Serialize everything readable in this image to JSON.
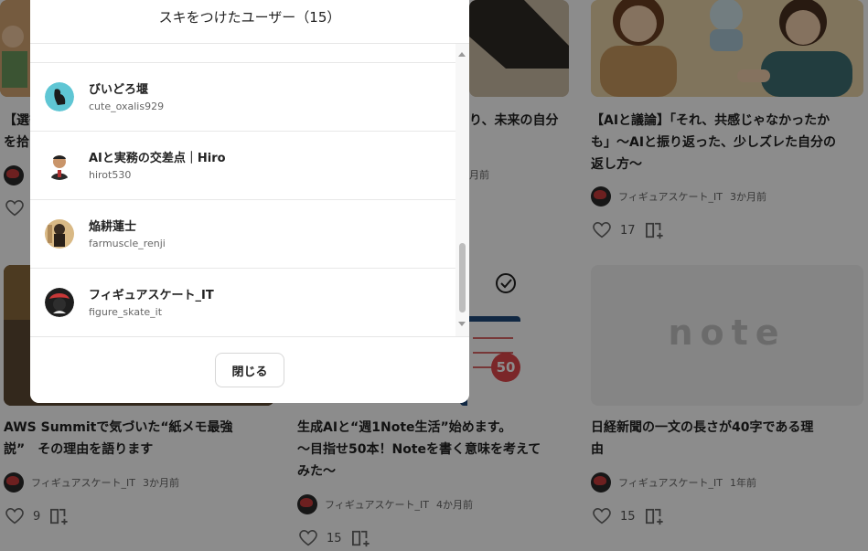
{
  "modal": {
    "title": "スキをつけたユーザー（15）",
    "close_label": "閉じる",
    "users": [
      {
        "name": "びいどろ堰",
        "handle": "cute_oxalis929"
      },
      {
        "name": "AIと実務の交差点｜Hiro",
        "handle": "hirot530"
      },
      {
        "name": "焔耕蓮士",
        "handle": "farmuscle_renji"
      },
      {
        "name": "フィギュアスケート_IT",
        "handle": "figure_skate_it"
      }
    ]
  },
  "cards": {
    "c1": {
      "title_l1": "【選挙",
      "title_l2": "を拾"
    },
    "c2": {
      "title": "り、未来の自分",
      "time": "月前"
    },
    "c3": {
      "title_l1": "【AIと議論】「それ、共感じゃなかったか",
      "title_l2": "も」〜AIと振り返った、少しズレた自分の",
      "title_l3": "返し方〜",
      "author": "フィギュアスケート_IT",
      "time": "3か月前",
      "likes": "17"
    },
    "c4": {
      "title_l1": "AWS Summitで気づいた“紙メモ最強",
      "title_l2": "説”　その理由を語ります",
      "author": "フィギュアスケート_IT",
      "time": "3か月前",
      "likes": "9"
    },
    "c5": {
      "title_l1": "生成AIと“週1Note生活”始めます。",
      "title_l2": "〜目指せ50本！Noteを書く意味を考えて",
      "title_l3": "みた〜",
      "author": "フィギュアスケート_IT",
      "time": "4か月前",
      "likes": "15",
      "badge": "50"
    },
    "c6": {
      "title_l1": "日経新聞の一文の長さが40字である理",
      "title_l2": "由",
      "author": "フィギュアスケート_IT",
      "time": "1年前",
      "likes": "15",
      "logo": "note"
    }
  }
}
